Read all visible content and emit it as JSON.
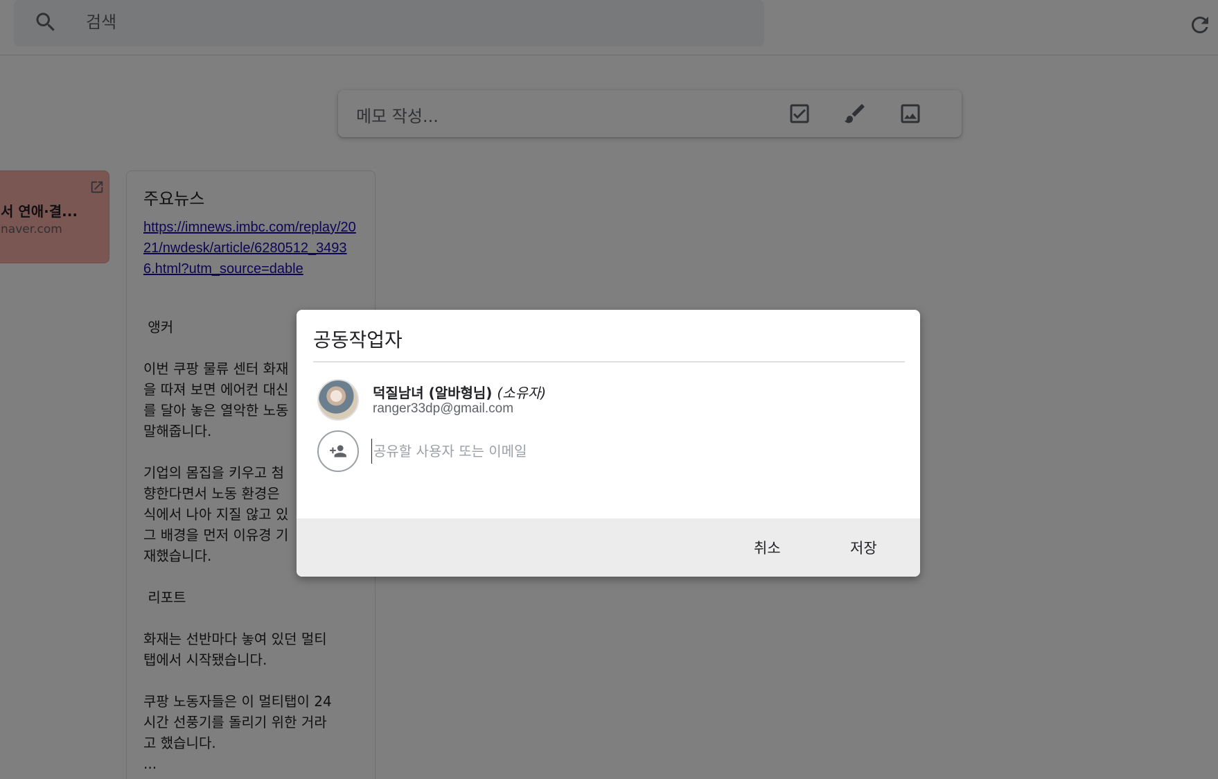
{
  "search": {
    "placeholder": "검색"
  },
  "composer": {
    "placeholder": "메모 작성..."
  },
  "cards": {
    "left": {
      "title": "서 연애·결...",
      "domain": "naver.com"
    },
    "note": {
      "title": "주요뉴스",
      "link": "https://imnews.imbc.com/replay/2021/nwdesk/article/6280512_34936.html?utm_source=dable",
      "body": " 앵커\n\n이번 쿠팡 물류 센터 화재\n을 따져 보면 에어컨 대신\n를 달아 놓은 열악한 노동\n말해줍니다.\n\n기업의 몸집을 키우고 첨\n향한다면서 노동 환경은\n식에서 나아 지질 않고 있\n그 배경을 먼저 이유경 기\n재했습니다.\n\n 리포트\n\n화재는 선반마다 놓여 있던 멀티\n탭에서 시작됐습니다.\n\n쿠팡 노동자들은 이 멀티탭이 24\n시간 선풍기를 돌리기 위한 거라\n고 했습니다.\n..."
    }
  },
  "dialog": {
    "title": "공동작업자",
    "owner": {
      "name": "덕질남녀 (알바형님)",
      "role": "(소유자)",
      "email": "ranger33dp@gmail.com"
    },
    "add_placeholder": "공유할 사용자 또는 이메일",
    "cancel_label": "취소",
    "save_label": "저장"
  }
}
